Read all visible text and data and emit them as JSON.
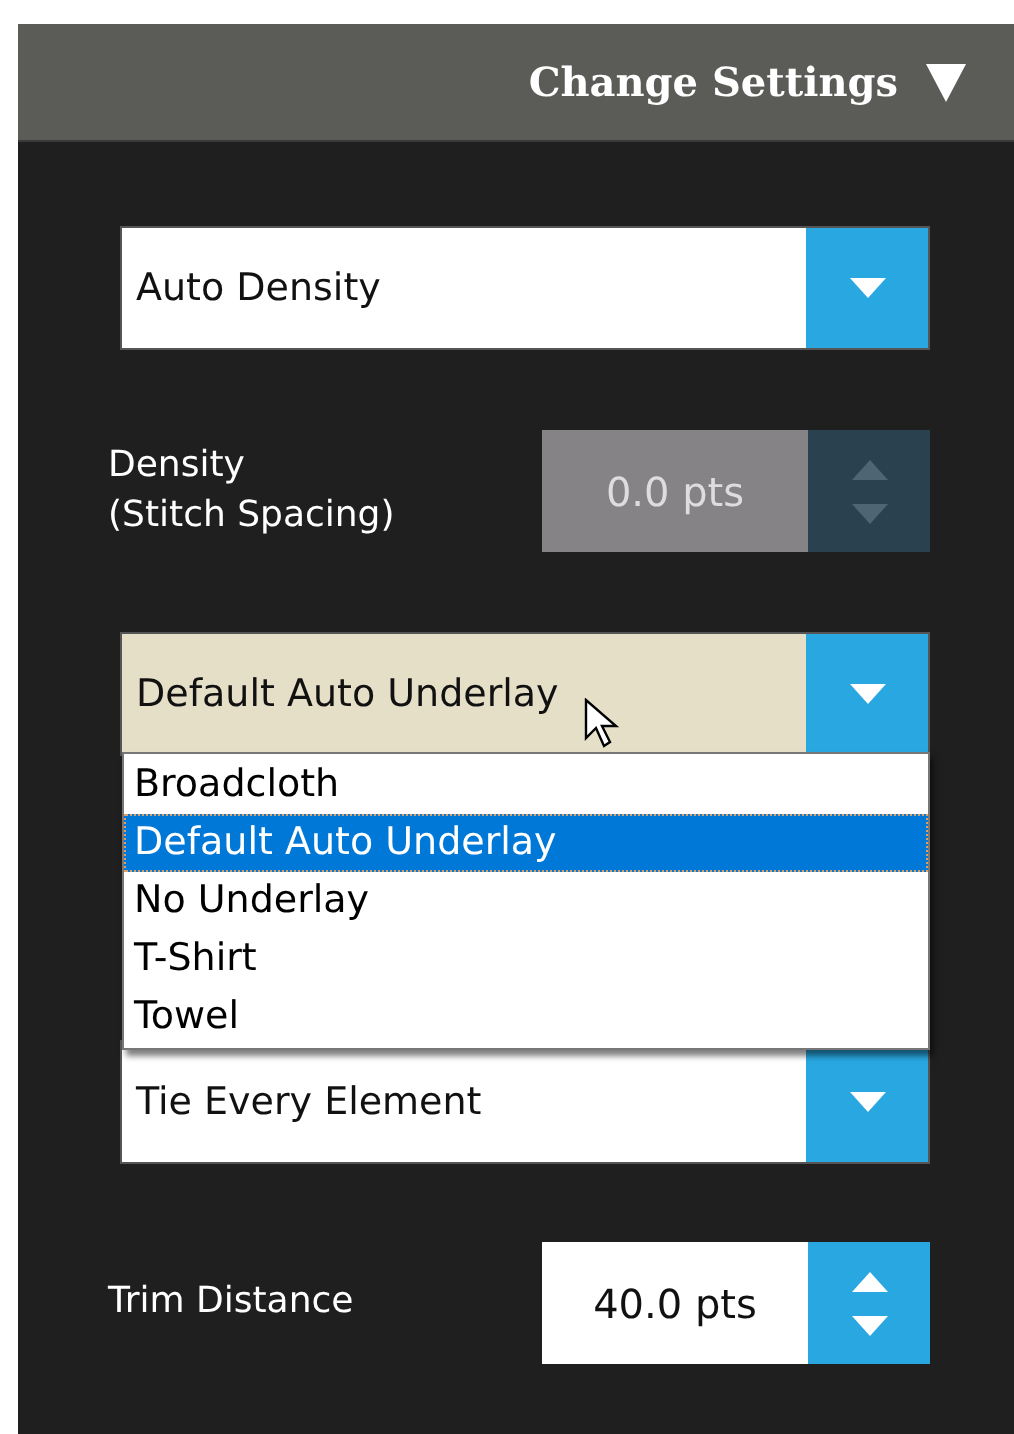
{
  "header": {
    "title": "Change Settings",
    "collapsed": false
  },
  "density_mode": {
    "value": "Auto Density"
  },
  "density": {
    "label_lines": [
      "Density",
      "(Stitch Spacing)"
    ],
    "value": "0.0 pts",
    "disabled": true
  },
  "underlay": {
    "value": "Default Auto Underlay",
    "hovered": true,
    "expanded": true,
    "options": [
      {
        "label": "Broadcloth",
        "selected": false
      },
      {
        "label": "Default Auto Underlay",
        "selected": true
      },
      {
        "label": "No Underlay",
        "selected": false
      },
      {
        "label": "T-Shirt",
        "selected": false
      },
      {
        "label": "Towel",
        "selected": false
      }
    ]
  },
  "tie": {
    "value": "Tie Every Element"
  },
  "trim": {
    "label": "Trim Distance",
    "value": "40.0 pts",
    "disabled": false
  }
}
